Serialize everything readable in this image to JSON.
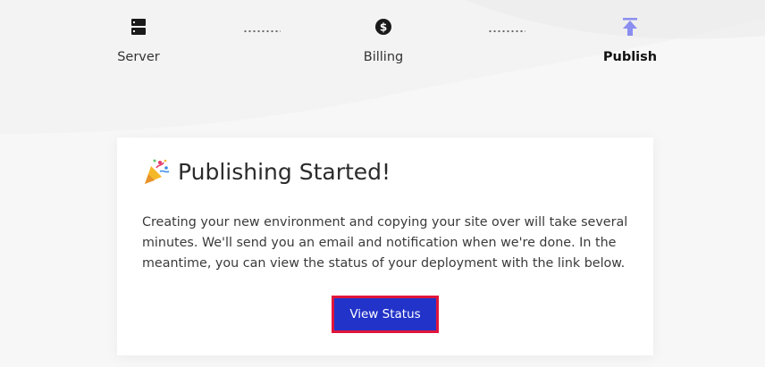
{
  "stepper": {
    "steps": [
      {
        "label": "Server",
        "icon": "server-icon",
        "active": false
      },
      {
        "label": "Billing",
        "icon": "dollar-coin-icon",
        "active": false
      },
      {
        "label": "Publish",
        "icon": "publish-upload-icon",
        "active": true
      }
    ]
  },
  "card": {
    "icon": "party-popper-icon",
    "title": "Publishing Started!",
    "body": "Creating your new environment and copying your site over will take several minutes. We'll send you an email and notification when we're done. In the meantime, you can view the status of your deployment with the link below.",
    "button_label": "View Status"
  },
  "colors": {
    "button": "#2233c9",
    "button_highlight": "#e0153c",
    "publish_icon": "#8a8ef0"
  }
}
